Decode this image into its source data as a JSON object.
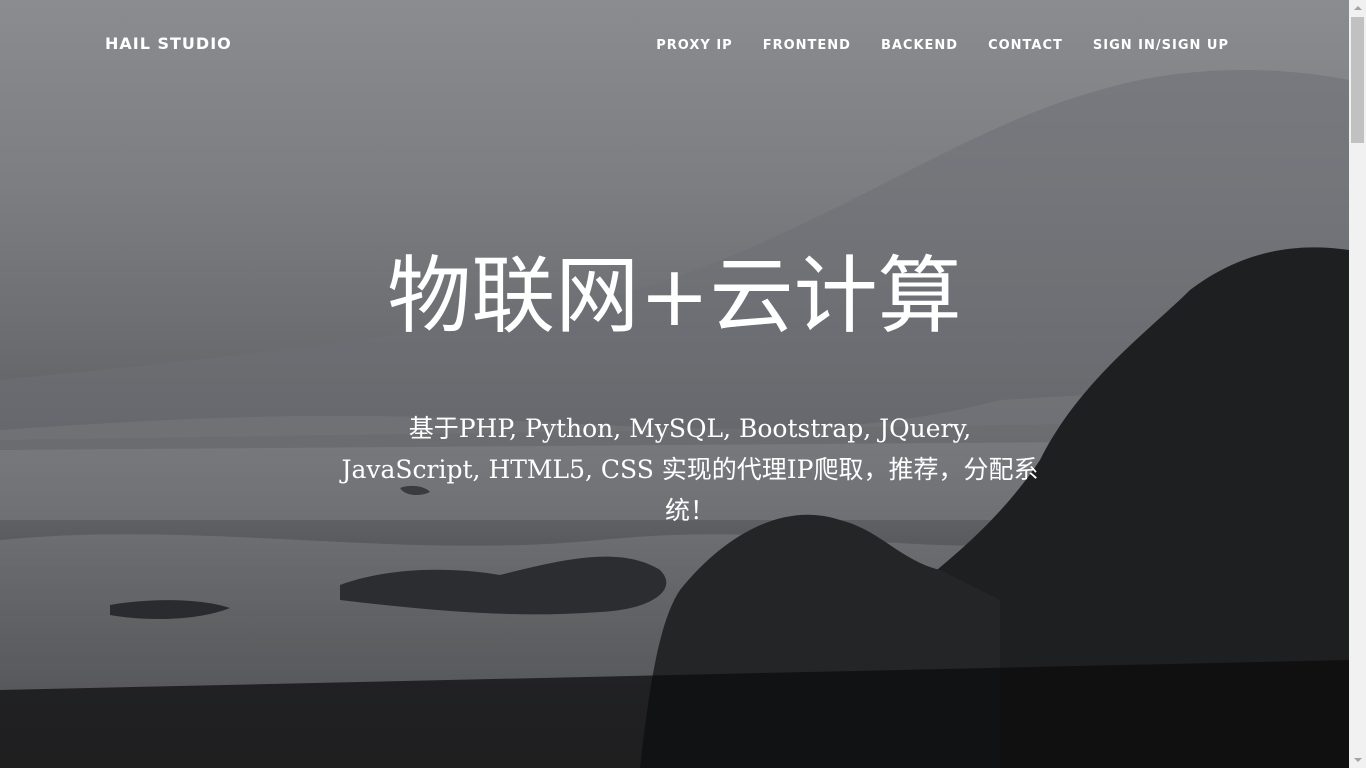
{
  "navbar": {
    "brand": "HAIL STUDIO",
    "links": [
      {
        "label": "PROXY IP"
      },
      {
        "label": "FRONTEND"
      },
      {
        "label": "BACKEND"
      },
      {
        "label": "CONTACT"
      },
      {
        "label": "SIGN IN/SIGN UP"
      }
    ]
  },
  "hero": {
    "title": "物联网+云计算",
    "subtitle": "基于PHP, Python, MySQL, Bootstrap, JQuery, JavaScript, HTML5, CSS 实现的代理IP爬取，推荐，分配系统！"
  },
  "colors": {
    "text": "#ffffff",
    "overlay_top": "#8a8c90",
    "overlay_bottom": "#000000"
  }
}
